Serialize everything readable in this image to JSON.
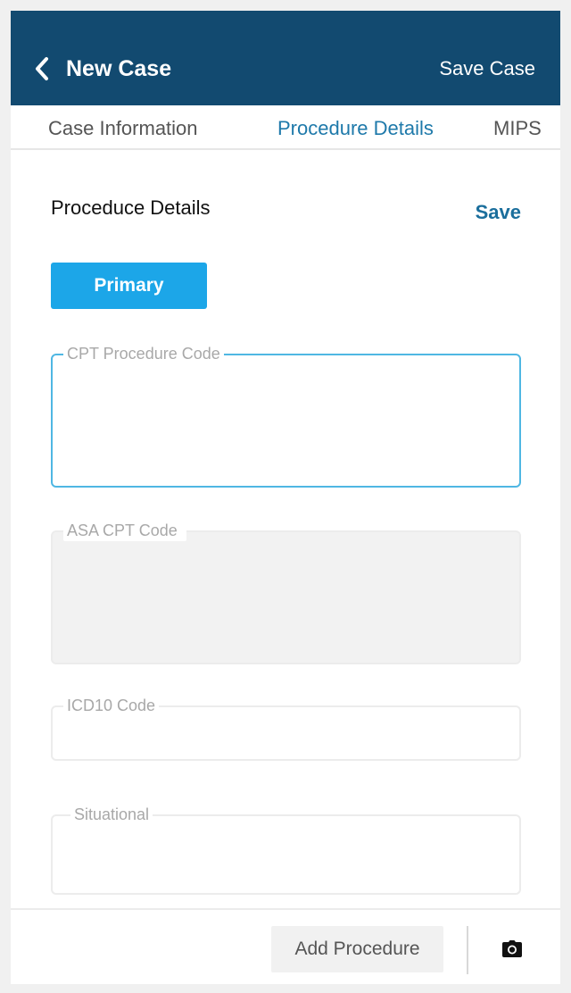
{
  "header": {
    "title": "New Case",
    "save_case_label": "Save Case",
    "back_icon": "chevron-left-icon",
    "background_color": "#124a70"
  },
  "tabs": [
    {
      "label": "Case Information",
      "active": false
    },
    {
      "label": "Procedure Details",
      "active": true
    },
    {
      "label": "MIPS",
      "active": false
    }
  ],
  "section": {
    "title": "Proceduce Details",
    "save_label": "Save",
    "primary_label": "Primary"
  },
  "fields": {
    "cpt": {
      "label": "CPT Procedure Code",
      "value": "",
      "state": "focused"
    },
    "asa": {
      "label": "ASA CPT Code",
      "value": "",
      "state": "disabled"
    },
    "icd": {
      "label": "ICD10 Code",
      "value": ""
    },
    "situational": {
      "label": "Situational",
      "value": ""
    }
  },
  "footer": {
    "add_procedure_label": "Add Procedure",
    "camera_icon": "camera-icon"
  },
  "colors": {
    "accent": "#1e79aa",
    "primary_button": "#1ca6e8",
    "focus_border": "#4fb7e3"
  }
}
